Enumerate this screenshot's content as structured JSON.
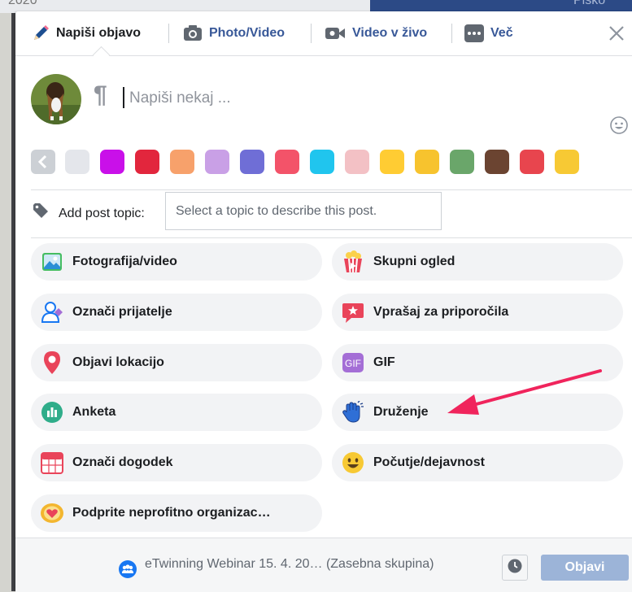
{
  "background": {
    "partial_left": "2020",
    "partial_right": "Pisko"
  },
  "tabs": [
    {
      "label": "Napiši objavo",
      "icon": "pencil-icon"
    },
    {
      "label": "Photo/Video",
      "icon": "camera-icon"
    },
    {
      "label": "Video v živo",
      "icon": "live-video-icon"
    },
    {
      "label": "Več",
      "icon": "more-icon"
    }
  ],
  "composer": {
    "placeholder": "Napiši nekaj ..."
  },
  "swatch_colors": [
    "#e4e6eb",
    "#c910e9",
    "#e2263d",
    "#f7a16b",
    "#c9a0e6",
    "#6f6ed6",
    "#f35369",
    "#20c5ee",
    "#f3c1c5",
    "#ffcc33",
    "#f7c32e",
    "#6aa66a",
    "#6b4431",
    "#e8454e",
    "#f7c934"
  ],
  "topic": {
    "label": "Add post topic:",
    "placeholder": "Select a topic to describe this post."
  },
  "options": [
    {
      "label": "Fotografija/video",
      "icon": "photo-icon"
    },
    {
      "label": "Skupni ogled",
      "icon": "watch-party-icon"
    },
    {
      "label": "Označi prijatelje",
      "icon": "tag-friends-icon"
    },
    {
      "label": "Vprašaj za priporočila",
      "icon": "recommendations-icon"
    },
    {
      "label": "Objavi lokacijo",
      "icon": "location-pin-icon"
    },
    {
      "label": "GIF",
      "icon": "gif-icon"
    },
    {
      "label": "Anketa",
      "icon": "poll-icon"
    },
    {
      "label": "Druženje",
      "icon": "hangout-hand-icon"
    },
    {
      "label": "Označi dogodek",
      "icon": "calendar-icon"
    },
    {
      "label": "Počutje/dejavnost",
      "icon": "smiley-icon"
    },
    {
      "label": "Podprite neprofitno organizac…",
      "icon": "nonprofit-heart-icon"
    }
  ],
  "footer": {
    "group_name": "eTwinning Webinar 15. 4. 20…",
    "group_privacy": "(Zasebna skupina)",
    "post_button": "Objavi"
  },
  "colors": {
    "fb_blue": "#385898",
    "arrow": "#f0245c",
    "post_button_disabled": "#9cb4d8"
  }
}
